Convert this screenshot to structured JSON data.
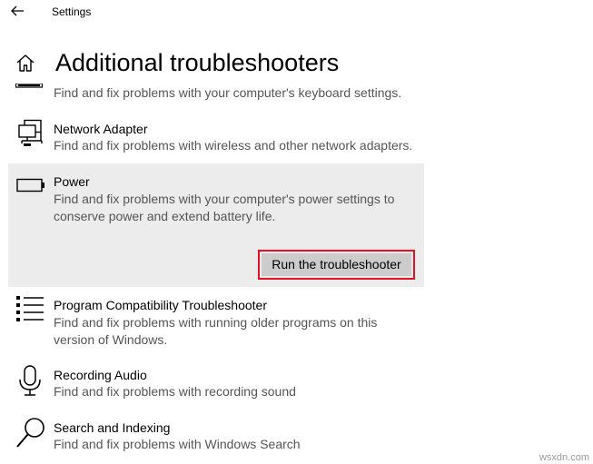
{
  "window": {
    "title": "Settings",
    "back_icon": "arrow-left-icon"
  },
  "header": {
    "home_icon": "home-icon",
    "title": "Additional troubleshooters"
  },
  "troubleshooters": [
    {
      "id": "keyboard",
      "name": "",
      "description": "Find and fix problems with your computer's keyboard settings.",
      "icon": "keyboard-icon"
    },
    {
      "id": "network-adapter",
      "name": "Network Adapter",
      "description": "Find and fix problems with wireless and other network adapters.",
      "icon": "network-computers-icon"
    },
    {
      "id": "power",
      "name": "Power",
      "description": "Find and fix problems with your computer's power settings to conserve power and extend battery life.",
      "icon": "battery-icon",
      "selected": true,
      "run_button_label": "Run the troubleshooter"
    },
    {
      "id": "program-compatibility",
      "name": "Program Compatibility Troubleshooter",
      "description": "Find and fix problems with running older programs on this version of Windows.",
      "icon": "list-icon"
    },
    {
      "id": "recording-audio",
      "name": "Recording Audio",
      "description": "Find and fix problems with recording sound",
      "icon": "microphone-icon"
    },
    {
      "id": "search-indexing",
      "name": "Search and Indexing",
      "description": "Find and fix problems with Windows Search",
      "icon": "search-icon"
    }
  ],
  "colors": {
    "selected_background": "#ececec",
    "button_background": "#cccccc",
    "highlight_border": "#e81123",
    "description_text": "#555555"
  },
  "watermark": "wsxdn.com"
}
